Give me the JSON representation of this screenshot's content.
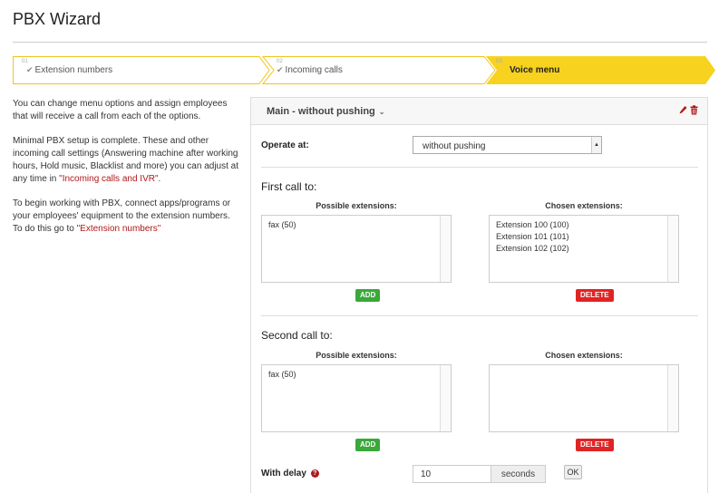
{
  "page": {
    "title": "PBX Wizard"
  },
  "wizard": {
    "steps": [
      {
        "num": "01",
        "label": "Extension numbers",
        "done": true
      },
      {
        "num": "02",
        "label": "Incoming calls",
        "done": true
      },
      {
        "num": "03",
        "label": "Voice menu",
        "active": true
      }
    ],
    "active_color": "#f7d21e",
    "border_color": "#f0c419"
  },
  "sidebar": {
    "p1": "You can change menu options and assign employees that will receive a call from each of the options.",
    "p2_text": "Minimal PBX setup is complete. These and other incoming call settings (Answering machine after working hours, Hold music, Blacklist and more) you can adjust at any time in ",
    "p2_link": "\"Incoming calls and IVR\"",
    "p2_end": ".",
    "p3_text": "To begin working with PBX, connect apps/programs or your employees' equipment to the extension numbers. To do this go to ",
    "p3_link": "\"Extension numbers\""
  },
  "panel": {
    "title": "Main - without pushing",
    "operate_label": "Operate at:",
    "operate_value": "without pushing",
    "first": {
      "title": "First call to:",
      "possible_label": "Possible extensions:",
      "chosen_label": "Chosen extensions:",
      "possible": [
        "fax (50)"
      ],
      "chosen": [
        "Extension 100 (100)",
        "Extension 101 (101)",
        "Extension 102 (102)"
      ],
      "add": "ADD",
      "delete": "DELETE"
    },
    "second": {
      "title": "Second call to:",
      "possible_label": "Possible extensions:",
      "chosen_label": "Chosen extensions:",
      "possible": [
        "fax (50)"
      ],
      "chosen": [],
      "add": "ADD",
      "delete": "DELETE"
    },
    "delay_label": "With delay",
    "delay_value": "10",
    "delay_unit": "seconds",
    "ok": "OK"
  },
  "icons": {
    "edit": "pencil-icon",
    "delete": "trash-icon",
    "help": "question-icon"
  }
}
